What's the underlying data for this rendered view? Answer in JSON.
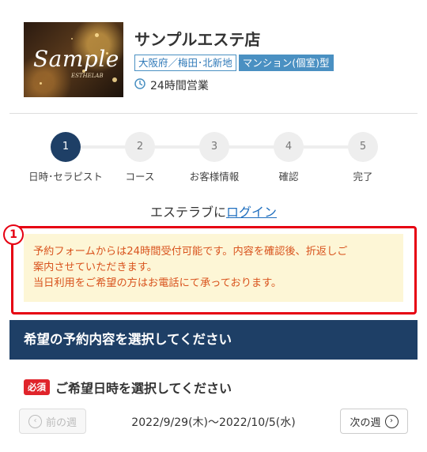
{
  "shop": {
    "image_text": "Sample",
    "image_subtext": "ESTHELAB",
    "name": "サンプルエステ店",
    "tag_area": "大阪府／梅田･北新地",
    "tag_type": "マンション(個室)型",
    "hours": "24時間営業",
    "icons": {
      "hours": "clock-icon"
    }
  },
  "steps": [
    {
      "number": "1",
      "label": "日時･セラピスト",
      "active": true
    },
    {
      "number": "2",
      "label": "コース",
      "active": false
    },
    {
      "number": "3",
      "label": "お客様情報",
      "active": false
    },
    {
      "number": "4",
      "label": "確認",
      "active": false
    },
    {
      "number": "5",
      "label": "完了",
      "active": false
    }
  ],
  "login": {
    "prefix": "エステラブに",
    "link": "ログイン"
  },
  "annotation": {
    "marker": "1",
    "color": "#e60012"
  },
  "notice": {
    "line1": "予約フォームからは24時間受付可能です。内容を確認後、折返しご",
    "line2": "案内させていただきます。",
    "line3": "当日利用をご希望の方はお電話にて承っております。",
    "background": "#fdf6d6",
    "text_color": "#d9541e"
  },
  "section": {
    "title": "希望の予約内容を選択してください",
    "color": "#1e3f66"
  },
  "datetime": {
    "required_badge": "必須",
    "title": "ご希望日時を選択してください",
    "prev_week": "前の週",
    "next_week": "次の週",
    "range": "2022/9/29(木)〜2022/10/5(水)",
    "icons": {
      "prev": "chevron-left-icon",
      "next": "chevron-right-icon"
    }
  }
}
